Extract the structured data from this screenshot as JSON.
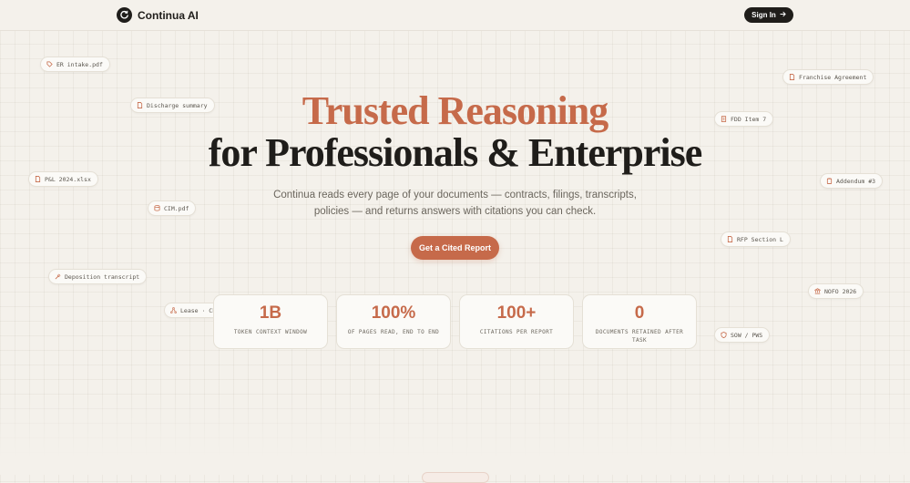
{
  "header": {
    "brand": "Continua AI",
    "signin_label": "Sign In",
    "logo_icon": "circular-arrow-icon",
    "signin_icon": "arrow-right-icon"
  },
  "hero": {
    "title_line1": "Trusted Reasoning",
    "title_line2": "for Professionals & Enterprise",
    "subtitle_line1": "Continua reads every page of your documents — contracts, filings, transcripts,",
    "subtitle_line2": "policies — and returns answers with citations you can check.",
    "cta_label": "Get a Cited Report"
  },
  "chips": [
    {
      "label": "ER intake.pdf",
      "icon": "tag-icon"
    },
    {
      "label": "Discharge summary",
      "icon": "document-icon"
    },
    {
      "label": "P&L 2024.xlsx",
      "icon": "document-icon"
    },
    {
      "label": "CIM.pdf",
      "icon": "database-icon"
    },
    {
      "label": "Deposition transcript",
      "icon": "gavel-icon"
    },
    {
      "label": "Lease · Ch",
      "icon": "network-icon"
    },
    {
      "label": "Franchise Agreement",
      "icon": "document-icon"
    },
    {
      "label": "FDD Item 7",
      "icon": "building-icon"
    },
    {
      "label": "Addendum #3",
      "icon": "clipboard-icon"
    },
    {
      "label": "RFP Section L",
      "icon": "document-icon"
    },
    {
      "label": "NOFO 2026",
      "icon": "bank-icon"
    },
    {
      "label": "SOW / PWS",
      "icon": "shield-icon"
    }
  ],
  "stats": [
    {
      "value": "1B",
      "label": "TOKEN CONTEXT WINDOW"
    },
    {
      "value": "100%",
      "label": "OF PAGES READ, END TO END"
    },
    {
      "value": "100+",
      "label": "CITATIONS PER REPORT"
    },
    {
      "value": "0",
      "label": "DOCUMENTS RETAINED AFTER TASK"
    }
  ],
  "colors": {
    "accent": "#c66a4a",
    "background": "#f4f1eb",
    "dark": "#1f1d1a"
  }
}
